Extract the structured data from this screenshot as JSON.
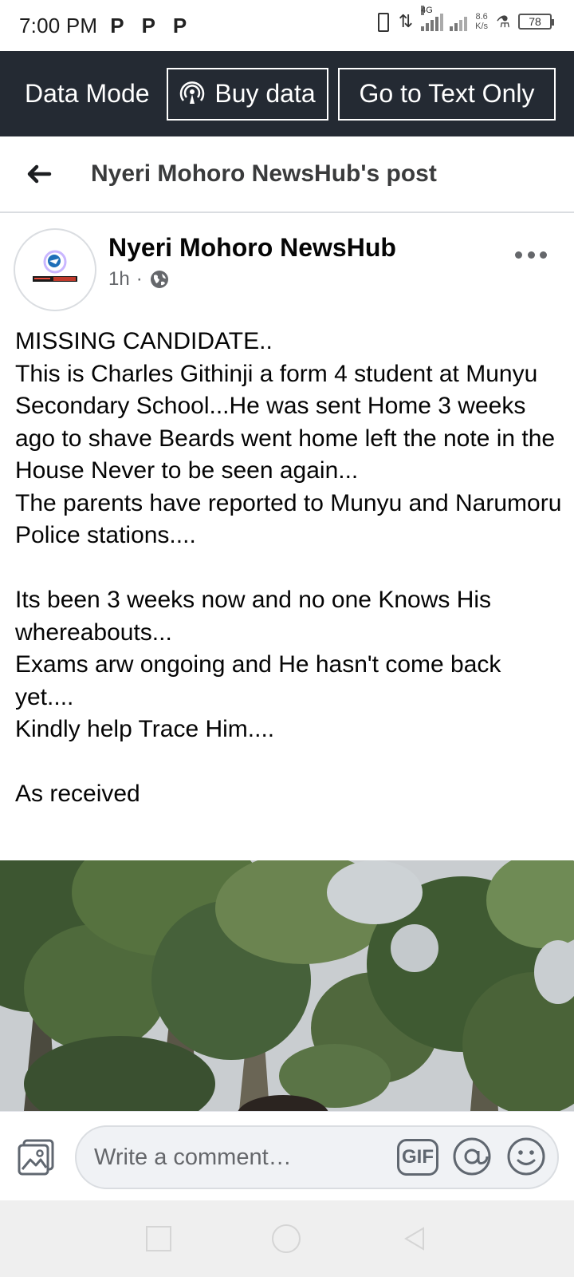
{
  "status_bar": {
    "time": "7:00 PM",
    "p_icons": [
      "P",
      "P",
      "P"
    ],
    "network_type": "4G",
    "speed_value": "8.6",
    "speed_unit": "K/s",
    "battery": "78"
  },
  "data_bar": {
    "mode_label": "Data Mode",
    "buy_data_label": "Buy data",
    "text_only_label": "Go to Text Only",
    "background_color": "#242a33"
  },
  "post_header": {
    "title": "Nyeri Mohoro NewsHub's post"
  },
  "post": {
    "author_name": "Nyeri Mohoro NewsHub",
    "time_ago": "1h",
    "meta_separator": "·",
    "privacy_icon": "globe-icon",
    "text": "MISSING CANDIDATE..\nThis is Charles Githinji a form 4 student at Munyu Secondary School...He was sent Home 3 weeks ago to shave Beards went home left the note in the House Never to be seen again...\nThe parents have reported to Munyu and Narumoru Police stations....\n\nIts been 3 weeks now and no one Knows His whereabouts...\nExams arw ongoing and He hasn't come back yet....\nKindly help Trace Him....\n\nAs received"
  },
  "comment_bar": {
    "placeholder": "Write a comment…",
    "gif_label": "GIF",
    "icons": [
      "photo-icon",
      "gif-icon",
      "at-icon",
      "smile-icon"
    ]
  },
  "nav_bar": {
    "icons": [
      "recent-apps-icon",
      "home-icon",
      "back-icon"
    ]
  }
}
